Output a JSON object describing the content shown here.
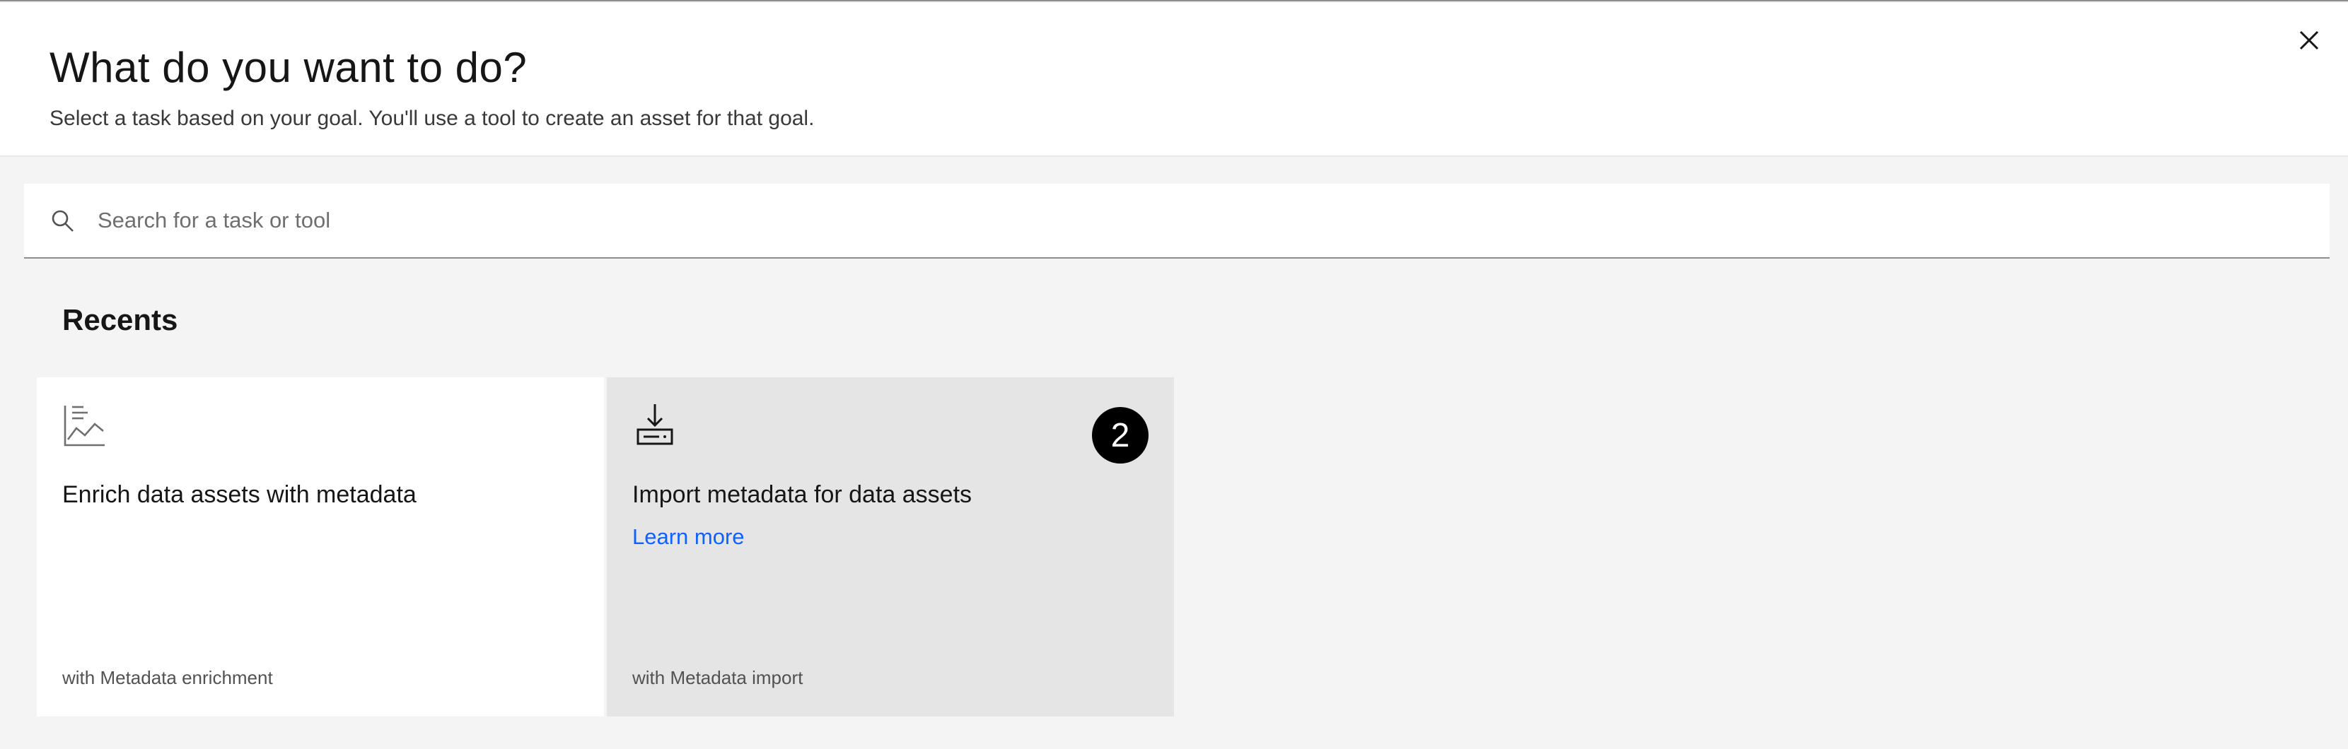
{
  "dialog": {
    "title": "What do you want to do?",
    "subtitle": "Select a task based on your goal. You'll use a tool to create an asset for that goal.",
    "close_icon": "close-icon"
  },
  "search": {
    "placeholder": "Search for a task or tool",
    "value": "",
    "icon": "search-icon"
  },
  "recents": {
    "heading": "Recents",
    "cards": [
      {
        "title": "Enrich data assets with metadata",
        "footer": "with Metadata enrichment",
        "icon": "chart-line-icon",
        "selected": false
      },
      {
        "title": "Import metadata for data assets",
        "link": "Learn more",
        "footer": "with Metadata import",
        "icon": "download-icon",
        "badge": "2",
        "selected": true
      }
    ]
  },
  "colors": {
    "link": "#0f62fe",
    "selected_card": "#e5e5e5",
    "background": "#f4f4f4",
    "badge": "#000000"
  }
}
